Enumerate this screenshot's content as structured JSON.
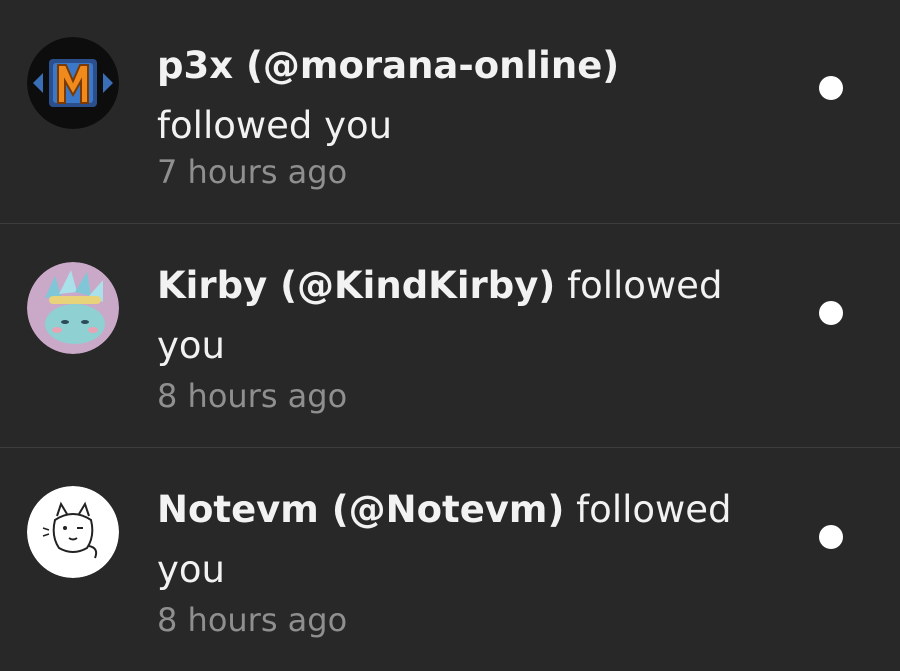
{
  "notifications": [
    {
      "name": "p3x (@morana-online)",
      "action": "followed you",
      "time": "7 hours ago",
      "avatar": "morana-logo-avatar",
      "avatar_letter": "M",
      "unread": true
    },
    {
      "name": "Kirby (@KindKirby)",
      "action": "followed you",
      "time": "8 hours ago",
      "avatar": "kirby-crystal-avatar",
      "unread": true
    },
    {
      "name": "Notevm (@Notevm)",
      "action": "followed you",
      "time": "8 hours ago",
      "avatar": "cat-sketch-avatar",
      "unread": true
    }
  ],
  "colors": {
    "background": "#282828",
    "divider": "#3d3d3d",
    "text": "#f2f2f2",
    "muted": "#8f8f8f",
    "unread_dot": "#ffffff",
    "morana_orange": "#f08a1c",
    "morana_blue": "#3a6fb8"
  }
}
